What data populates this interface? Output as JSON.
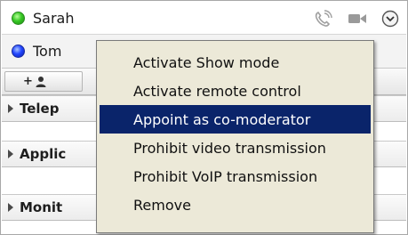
{
  "participants": [
    {
      "name": "Sarah",
      "status_color": "#2fbf1f"
    },
    {
      "name": "Tom",
      "status_color": "#1f3cff"
    }
  ],
  "row_icons": [
    "voip-icon",
    "video-camera-icon",
    "dropdown-menu-icon"
  ],
  "toolbar": {
    "add_button_label": "+",
    "add_button_icon": "person-icon"
  },
  "sections": [
    {
      "label": "Telep"
    },
    {
      "label": "Applic"
    },
    {
      "label": "Monit"
    }
  ],
  "context_menu": {
    "items": [
      {
        "label": "Activate Show mode",
        "selected": false
      },
      {
        "label": "Activate remote control",
        "selected": false
      },
      {
        "label": "Appoint as co-moderator",
        "selected": true
      },
      {
        "label": "Prohibit video transmission",
        "selected": false
      },
      {
        "label": "Prohibit VoIP transmission",
        "selected": false
      },
      {
        "label": "Remove",
        "selected": false
      }
    ],
    "highlight_color": "#0a246a"
  }
}
